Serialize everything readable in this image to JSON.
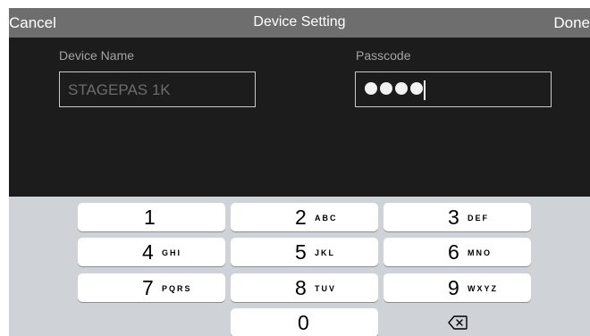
{
  "navbar": {
    "cancel_label": "Cancel",
    "title": "Device Setting",
    "done_label": "Done"
  },
  "form": {
    "device_name_label": "Device Name",
    "device_name_value": "STAGEPAS 1K",
    "passcode_label": "Passcode",
    "passcode_dot_count": 4
  },
  "keypad": {
    "keys": [
      {
        "digit": "1",
        "letters": ""
      },
      {
        "digit": "2",
        "letters": "ABC"
      },
      {
        "digit": "3",
        "letters": "DEF"
      },
      {
        "digit": "4",
        "letters": "GHI"
      },
      {
        "digit": "5",
        "letters": "JKL"
      },
      {
        "digit": "6",
        "letters": "MNO"
      },
      {
        "digit": "7",
        "letters": "PQRS"
      },
      {
        "digit": "8",
        "letters": "TUV"
      },
      {
        "digit": "9",
        "letters": "WXYZ"
      },
      {
        "digit": "0",
        "letters": ""
      }
    ],
    "backspace_icon": "backspace-icon"
  },
  "colors": {
    "navbar_bg": "#6e6e6e",
    "screen_bg": "#1c1c1c",
    "keyboard_bg": "#cfd2d6",
    "key_bg": "#ffffff"
  }
}
